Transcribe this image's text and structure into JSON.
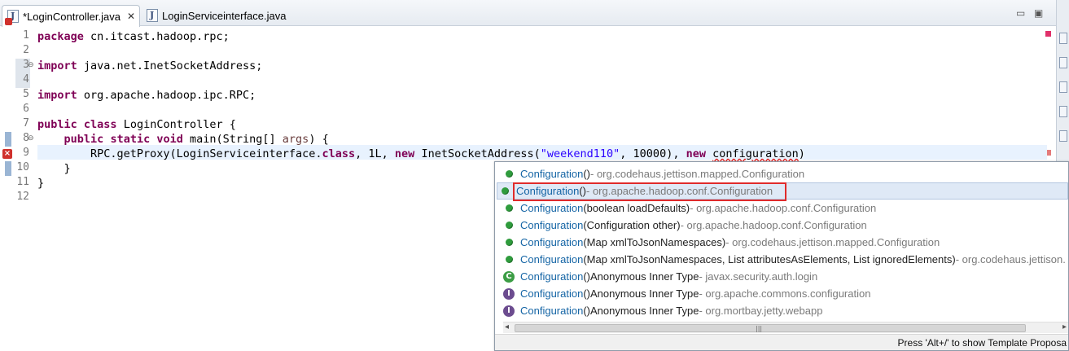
{
  "tabs": [
    {
      "label": "*LoginController.java",
      "icon": "java-file-error-icon"
    },
    {
      "label": "LoginServiceinterface.java",
      "icon": "java-file-icon"
    }
  ],
  "window_controls": {
    "minimize": "▭",
    "maximize": "▣"
  },
  "editor": {
    "lines": [
      {
        "no": "1",
        "tokens": [
          {
            "t": "kw",
            "v": "package"
          },
          {
            "t": "p",
            "v": " cn.itcast.hadoop.rpc;"
          }
        ]
      },
      {
        "no": "2",
        "tokens": []
      },
      {
        "no": "3",
        "tokens": [
          {
            "t": "kw",
            "v": "import"
          },
          {
            "t": "p",
            "v": " java.net.InetSocketAddress;"
          }
        ]
      },
      {
        "no": "4",
        "tokens": []
      },
      {
        "no": "5",
        "tokens": [
          {
            "t": "kw",
            "v": "import"
          },
          {
            "t": "p",
            "v": " org.apache.hadoop.ipc.RPC;"
          }
        ]
      },
      {
        "no": "6",
        "tokens": []
      },
      {
        "no": "7",
        "tokens": [
          {
            "t": "kw",
            "v": "public"
          },
          {
            "t": "p",
            "v": " "
          },
          {
            "t": "kw",
            "v": "class"
          },
          {
            "t": "p",
            "v": " LoginController {"
          }
        ]
      },
      {
        "no": "8",
        "tokens": [
          {
            "t": "p",
            "v": "    "
          },
          {
            "t": "kw",
            "v": "public"
          },
          {
            "t": "p",
            "v": " "
          },
          {
            "t": "kw",
            "v": "static"
          },
          {
            "t": "p",
            "v": " "
          },
          {
            "t": "kw",
            "v": "void"
          },
          {
            "t": "p",
            "v": " main(String[] "
          },
          {
            "t": "param",
            "v": "args"
          },
          {
            "t": "p",
            "v": ") {"
          }
        ]
      },
      {
        "no": "9",
        "tokens": [
          {
            "t": "p",
            "v": "        RPC.getProxy(LoginServiceinterface."
          },
          {
            "t": "kw",
            "v": "class"
          },
          {
            "t": "p",
            "v": ", 1L, "
          },
          {
            "t": "kw",
            "v": "new"
          },
          {
            "t": "p",
            "v": " InetSocketAddress("
          },
          {
            "t": "str",
            "v": "\"weekend110\""
          },
          {
            "t": "p",
            "v": ", 10000), "
          },
          {
            "t": "kw",
            "v": "new"
          },
          {
            "t": "p",
            "v": " "
          },
          {
            "t": "err",
            "v": "configuration"
          },
          {
            "t": "p",
            "v": ")"
          }
        ]
      },
      {
        "no": "10",
        "tokens": [
          {
            "t": "p",
            "v": "    }"
          }
        ]
      },
      {
        "no": "11",
        "tokens": [
          {
            "t": "p",
            "v": "}"
          }
        ]
      },
      {
        "no": "12",
        "tokens": []
      }
    ]
  },
  "content_assist": {
    "items": [
      {
        "icon": "public-method-icon",
        "name": "Configuration",
        "sig": "()",
        "extra": "",
        "pkg": " - org.codehaus.jettison.mapped.Configuration"
      },
      {
        "icon": "public-method-icon",
        "name": "Configuration",
        "sig": "()",
        "extra": "",
        "pkg": " - org.apache.hadoop.conf.Configuration"
      },
      {
        "icon": "public-method-icon",
        "name": "Configuration",
        "sig": "(boolean loadDefaults)",
        "extra": "",
        "pkg": " - org.apache.hadoop.conf.Configuration"
      },
      {
        "icon": "public-method-icon",
        "name": "Configuration",
        "sig": "(Configuration other)",
        "extra": "",
        "pkg": " - org.apache.hadoop.conf.Configuration"
      },
      {
        "icon": "public-method-icon",
        "name": "Configuration",
        "sig": "(Map xmlToJsonNamespaces)",
        "extra": "",
        "pkg": " - org.codehaus.jettison.mapped.Configuration"
      },
      {
        "icon": "public-method-icon",
        "name": "Configuration",
        "sig": "(Map xmlToJsonNamespaces, List attributesAsElements, List ignoredElements)",
        "extra": "",
        "pkg": " - org.codehaus.jettison."
      },
      {
        "icon": "class-icon",
        "name": "Configuration",
        "sig": "()",
        "extra": "  Anonymous Inner Type",
        "pkg": " - javax.security.auth.login"
      },
      {
        "icon": "interface-icon",
        "name": "Configuration",
        "sig": "()",
        "extra": "  Anonymous Inner Type",
        "pkg": " - org.apache.commons.configuration"
      },
      {
        "icon": "interface-icon",
        "name": "Configuration",
        "sig": "()",
        "extra": "  Anonymous Inner Type",
        "pkg": " - org.mortbay.jetty.webapp"
      }
    ],
    "selected_index": 1,
    "status_text": "Press 'Alt+/' to show Template Proposa",
    "scroll_left": "◂",
    "scroll_right": "▸",
    "scroll_grip": "|||"
  }
}
